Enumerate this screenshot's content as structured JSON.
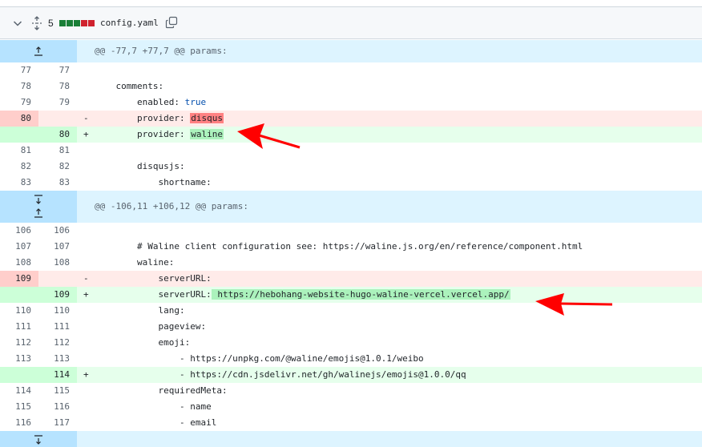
{
  "file_header": {
    "changes_count": "5",
    "filename": "config.yaml",
    "diffstat_squares": [
      "#1a7f37",
      "#1a7f37",
      "#1a7f37",
      "#cf222e",
      "#cf222e"
    ]
  },
  "hunks": [
    {
      "header": "@@ -77,7 +77,7 @@ params:"
    },
    {
      "header": "@@ -106,11 +106,12 @@ params:"
    }
  ],
  "block1": [
    {
      "type": "ctx",
      "old": "77",
      "new": "77",
      "marker": "",
      "code": ""
    },
    {
      "type": "ctx",
      "old": "78",
      "new": "78",
      "marker": "",
      "code": "    comments:"
    },
    {
      "type": "ctx",
      "old": "79",
      "new": "79",
      "marker": "",
      "code": "        enabled: ",
      "kw": "true"
    },
    {
      "type": "del",
      "old": "80",
      "new": "",
      "marker": "-",
      "code": "        provider: ",
      "hl": "disqus"
    },
    {
      "type": "add",
      "old": "",
      "new": "80",
      "marker": "+",
      "code": "        provider: ",
      "hl": "waline"
    },
    {
      "type": "ctx",
      "old": "81",
      "new": "81",
      "marker": "",
      "code": ""
    },
    {
      "type": "ctx",
      "old": "82",
      "new": "82",
      "marker": "",
      "code": "        disqusjs:"
    },
    {
      "type": "ctx",
      "old": "83",
      "new": "83",
      "marker": "",
      "code": "            shortname:"
    }
  ],
  "block2": [
    {
      "type": "ctx",
      "old": "106",
      "new": "106",
      "marker": "",
      "code": ""
    },
    {
      "type": "ctx",
      "old": "107",
      "new": "107",
      "marker": "",
      "code": "        # Waline client configuration see: https://waline.js.org/en/reference/component.html"
    },
    {
      "type": "ctx",
      "old": "108",
      "new": "108",
      "marker": "",
      "code": "        waline:"
    },
    {
      "type": "del",
      "old": "109",
      "new": "",
      "marker": "-",
      "code": "            serverURL:"
    },
    {
      "type": "add",
      "old": "",
      "new": "109",
      "marker": "+",
      "code": "            serverURL:",
      "hl": " https://hebohang-website-hugo-waline-vercel.vercel.app/"
    },
    {
      "type": "ctx",
      "old": "110",
      "new": "110",
      "marker": "",
      "code": "            lang:"
    },
    {
      "type": "ctx",
      "old": "111",
      "new": "111",
      "marker": "",
      "code": "            pageview:"
    },
    {
      "type": "ctx",
      "old": "112",
      "new": "112",
      "marker": "",
      "code": "            emoji:"
    },
    {
      "type": "ctx",
      "old": "113",
      "new": "113",
      "marker": "",
      "code": "                - https://unpkg.com/@waline/emojis@1.0.1/weibo"
    },
    {
      "type": "add",
      "old": "",
      "new": "114",
      "marker": "+",
      "code": "                - https://cdn.jsdelivr.net/gh/walinejs/emojis@1.0.0/qq"
    },
    {
      "type": "ctx",
      "old": "114",
      "new": "115",
      "marker": "",
      "code": "            requiredMeta:"
    },
    {
      "type": "ctx",
      "old": "115",
      "new": "116",
      "marker": "",
      "code": "                - name"
    },
    {
      "type": "ctx",
      "old": "116",
      "new": "117",
      "marker": "",
      "code": "                - email"
    }
  ]
}
